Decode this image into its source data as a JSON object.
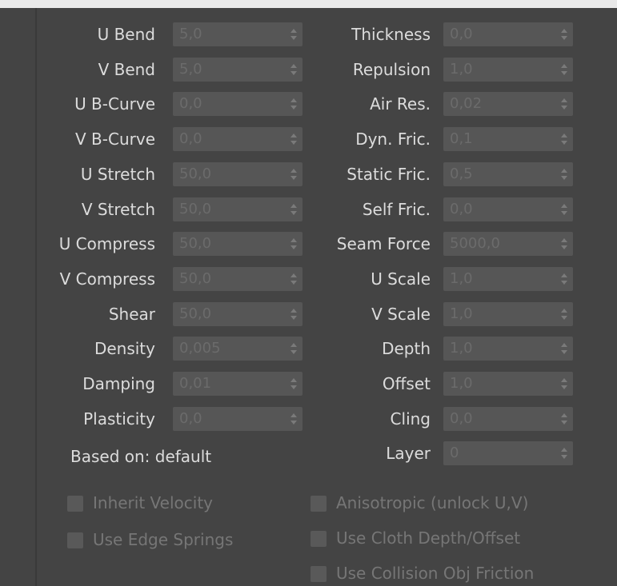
{
  "left_params": [
    {
      "label": "U Bend",
      "value": "5,0"
    },
    {
      "label": "V Bend",
      "value": "5,0"
    },
    {
      "label": "U B-Curve",
      "value": "0,0"
    },
    {
      "label": "V B-Curve",
      "value": "0,0"
    },
    {
      "label": "U Stretch",
      "value": "50,0"
    },
    {
      "label": "V Stretch",
      "value": "50,0"
    },
    {
      "label": "U Compress",
      "value": "50,0"
    },
    {
      "label": "V Compress",
      "value": "50,0"
    },
    {
      "label": "Shear",
      "value": "50,0"
    },
    {
      "label": "Density",
      "value": "0,005"
    },
    {
      "label": "Damping",
      "value": "0,01"
    },
    {
      "label": "Plasticity",
      "value": "0,0"
    }
  ],
  "right_params": [
    {
      "label": "Thickness",
      "value": "0,0"
    },
    {
      "label": "Repulsion",
      "value": "1,0"
    },
    {
      "label": "Air Res.",
      "value": "0,02"
    },
    {
      "label": "Dyn. Fric.",
      "value": "0,1"
    },
    {
      "label": "Static Fric.",
      "value": "0,5"
    },
    {
      "label": "Self Fric.",
      "value": "0,0"
    },
    {
      "label": "Seam Force",
      "value": "5000,0"
    },
    {
      "label": "U Scale",
      "value": "1,0"
    },
    {
      "label": "V Scale",
      "value": "1,0"
    },
    {
      "label": "Depth",
      "value": "1,0"
    },
    {
      "label": "Offset",
      "value": "1,0"
    },
    {
      "label": "Cling",
      "value": "0,0"
    },
    {
      "label": "Layer",
      "value": "0"
    }
  ],
  "based_on": "Based on: default",
  "checkboxes_left": [
    {
      "label": "Inherit Velocity"
    },
    {
      "label": "Use Edge Springs"
    }
  ],
  "checkboxes_right": [
    {
      "label": "Anisotropic (unlock U,V)"
    },
    {
      "label": "Use Cloth Depth/Offset"
    },
    {
      "label": "Use Collision Obj Friction"
    }
  ],
  "icons": {
    "spinner": "spinner-arrows-icon",
    "checkbox": "checkbox-icon"
  },
  "colors": {
    "panel_bg": "#444444",
    "field_bg": "#565656",
    "label_text": "#dcdcdc",
    "disabled_text": "#767676"
  }
}
